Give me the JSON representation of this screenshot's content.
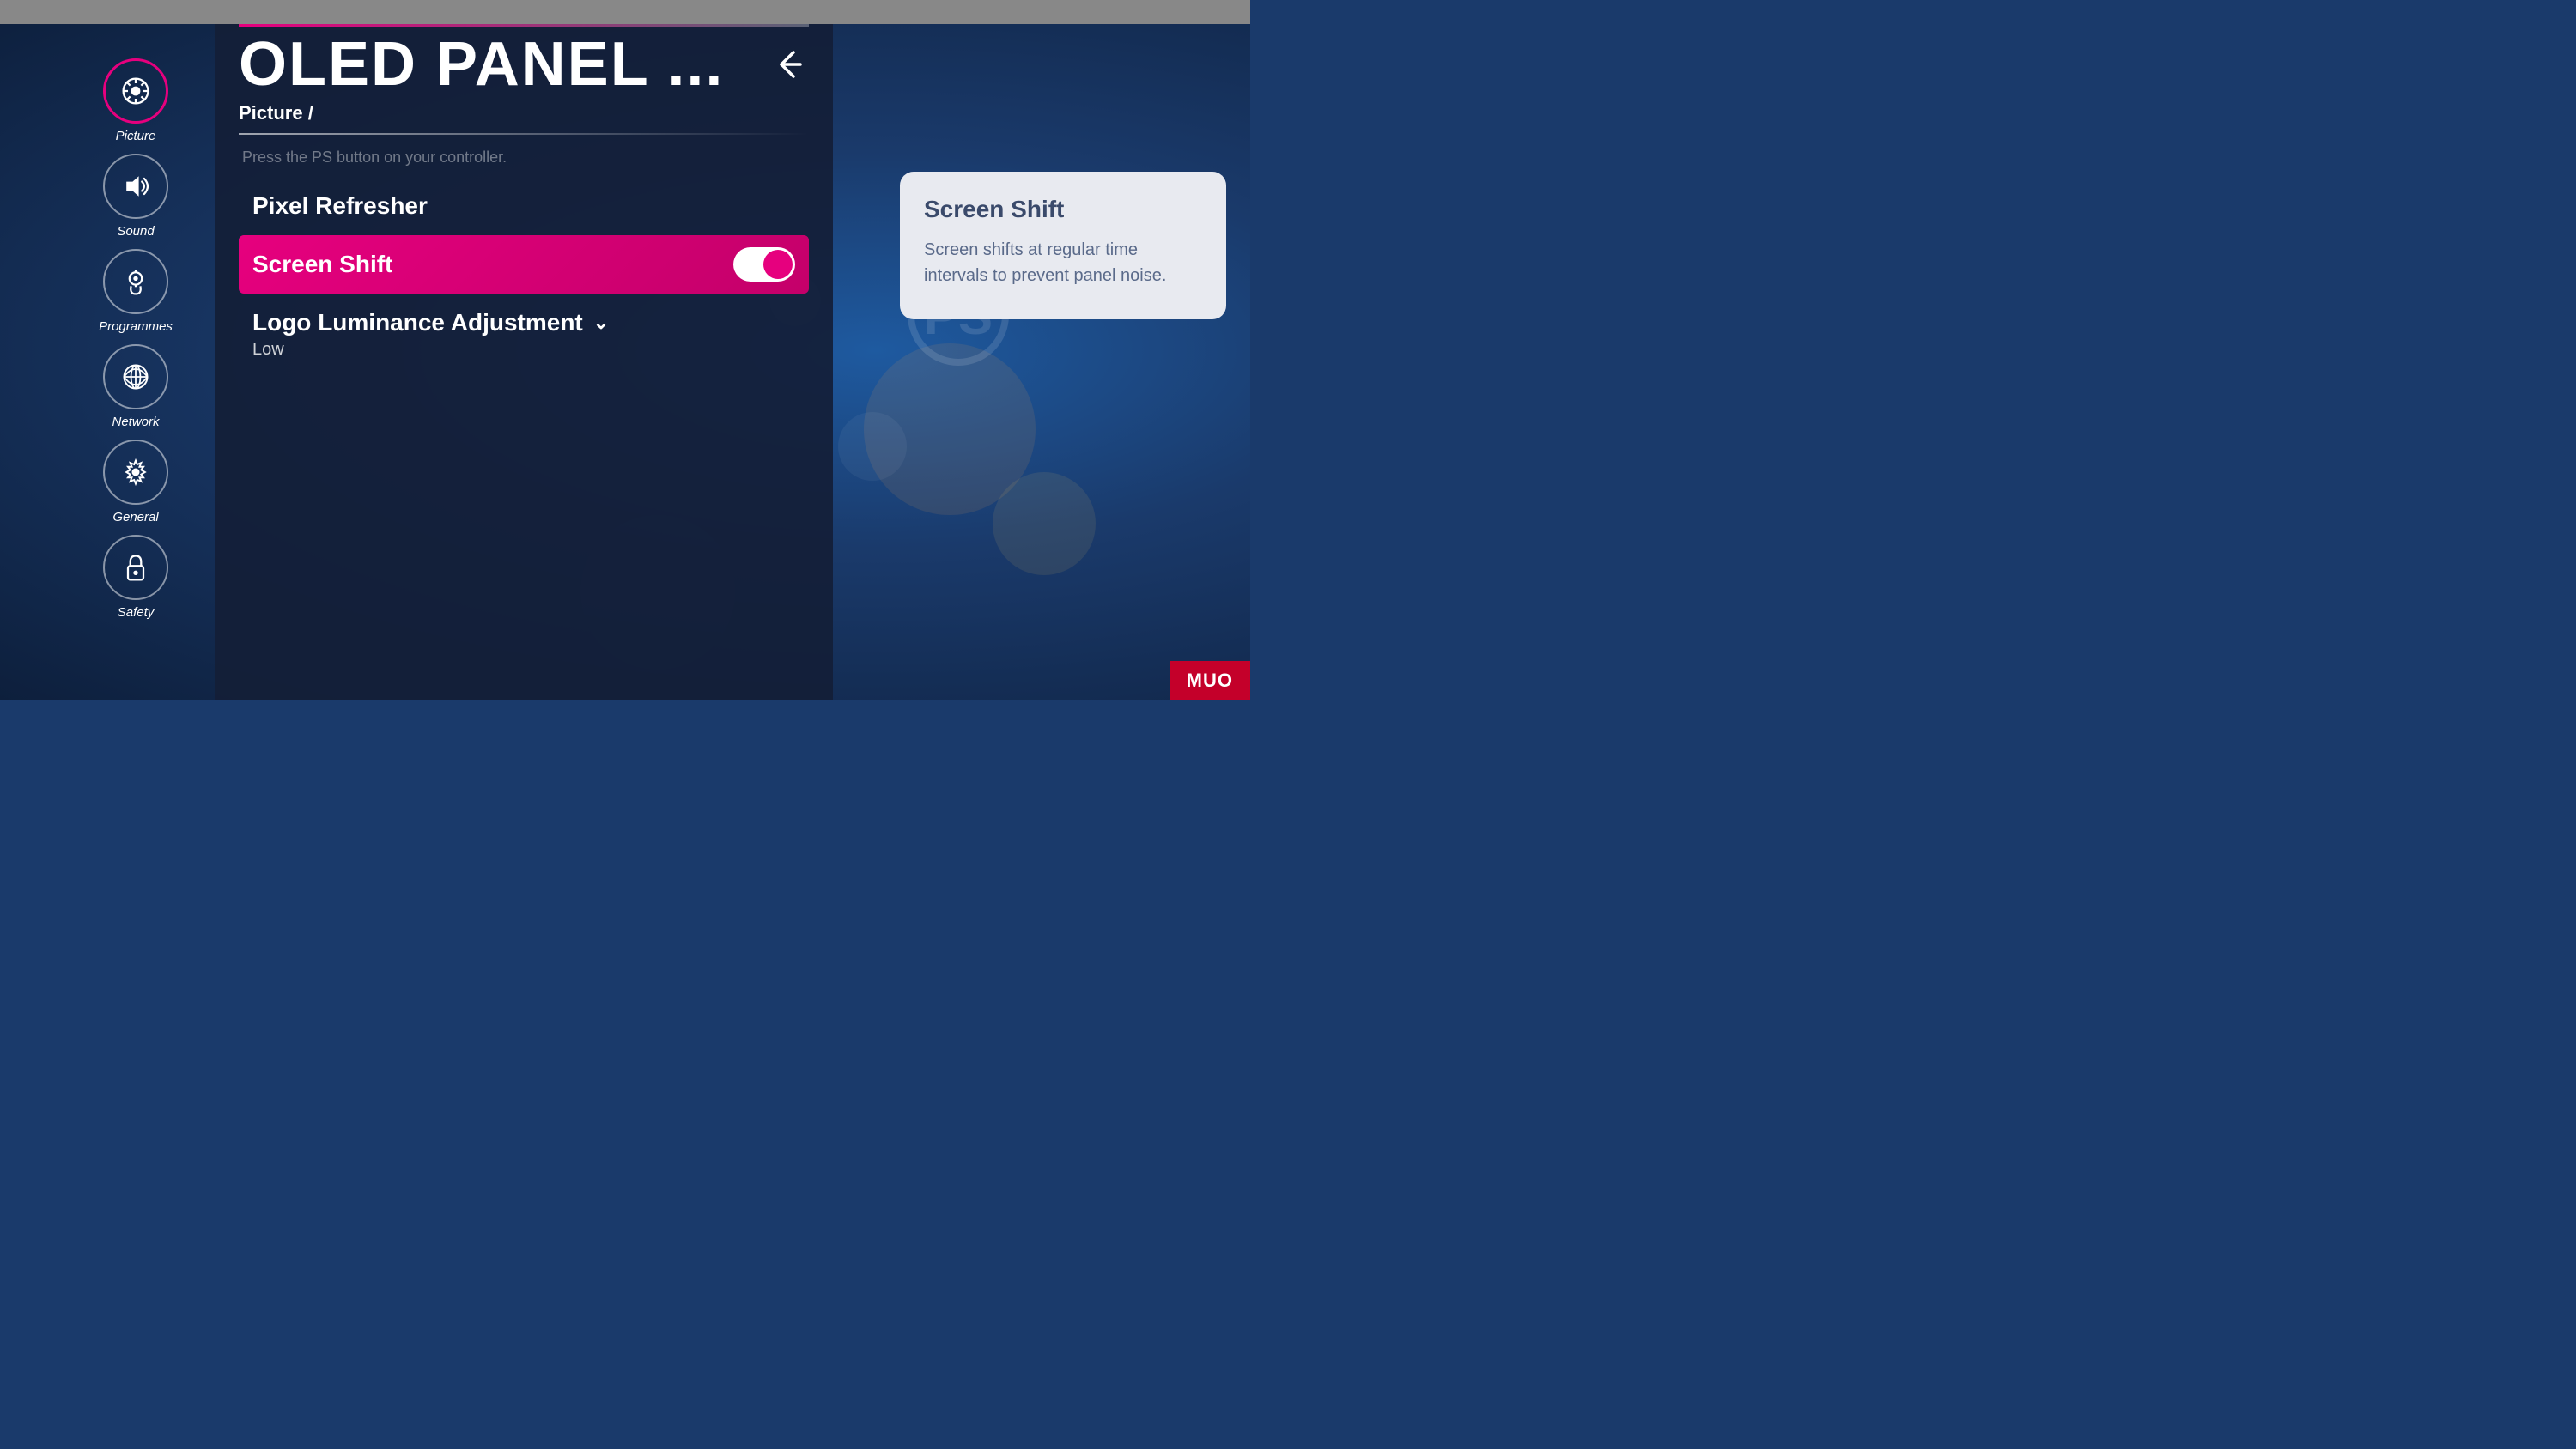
{
  "topBar": {},
  "sidebar": {
    "items": [
      {
        "id": "picture",
        "label": "Picture",
        "active": true,
        "icon": "picture-icon"
      },
      {
        "id": "sound",
        "label": "Sound",
        "active": false,
        "icon": "sound-icon"
      },
      {
        "id": "programmes",
        "label": "Programmes",
        "active": false,
        "icon": "programmes-icon"
      },
      {
        "id": "network",
        "label": "Network",
        "active": false,
        "icon": "network-icon"
      },
      {
        "id": "general",
        "label": "General",
        "active": false,
        "icon": "general-icon"
      },
      {
        "id": "safety",
        "label": "Safety",
        "active": false,
        "icon": "safety-icon"
      }
    ]
  },
  "panel": {
    "title": "OLED PANEL ...",
    "breadcrumb": "Picture /",
    "psHint": "Press the PS button on your controller.",
    "items": [
      {
        "id": "pixel-refresher",
        "label": "Pixel Refresher",
        "active": false
      },
      {
        "id": "screen-shift",
        "label": "Screen Shift",
        "active": true,
        "toggleOn": true
      },
      {
        "id": "logo-luminance",
        "label": "Logo Luminance Adjustment",
        "active": false,
        "value": "Low",
        "hasDropdown": true
      }
    ]
  },
  "tooltip": {
    "title": "Screen Shift",
    "body": "Screen shifts at regular time intervals to prevent panel noise."
  },
  "muoBadge": {
    "label": "MUO"
  },
  "colors": {
    "accent": "#e6007e",
    "sidebarActiveBorder": "#e6007e",
    "panelBg": "rgba(20,30,55,0.92)",
    "tooltipBg": "#e8eaf0",
    "tooltipTitle": "#3a4a6b",
    "tooltipBody": "#5a6a8a"
  }
}
